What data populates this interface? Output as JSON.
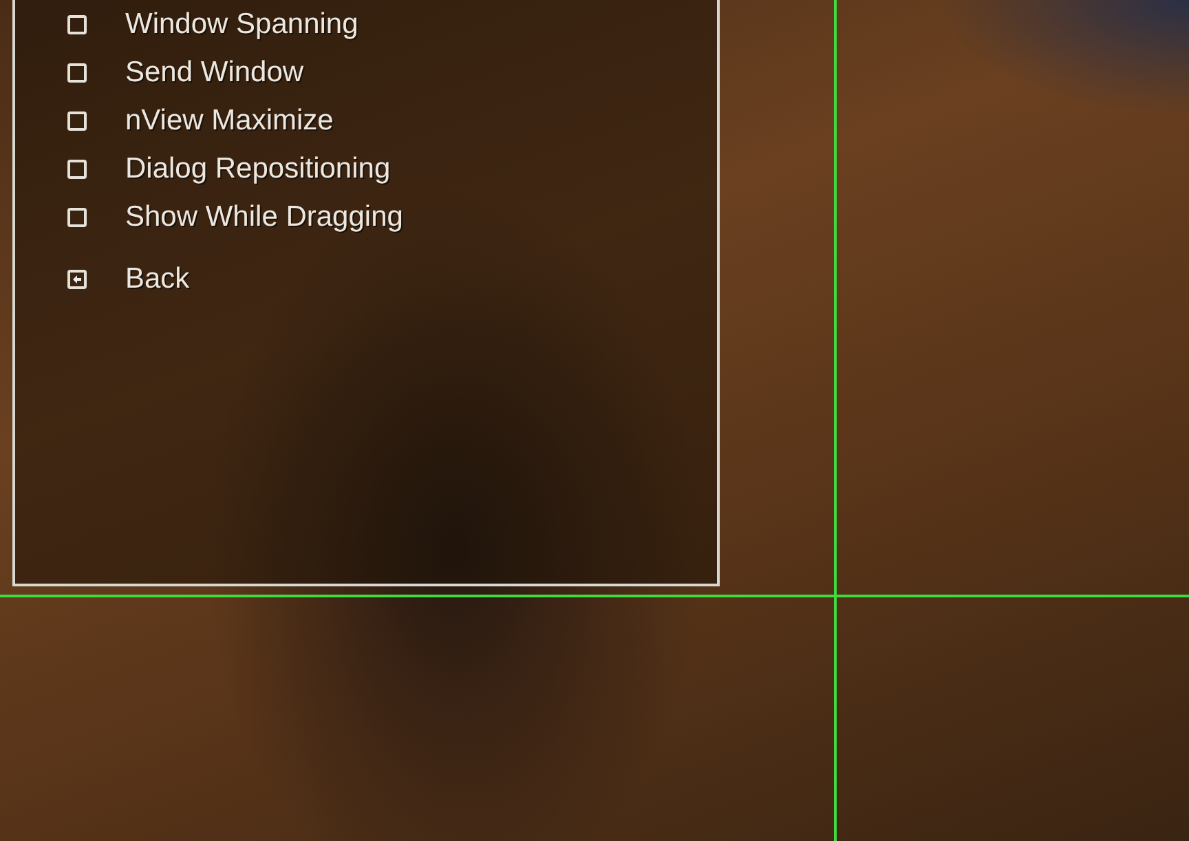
{
  "menu": {
    "items": [
      {
        "kind": "checkbox",
        "label": "Window Spanning",
        "checked": false
      },
      {
        "kind": "checkbox",
        "label": "Send Window",
        "checked": false
      },
      {
        "kind": "checkbox",
        "label": "nView Maximize",
        "checked": false
      },
      {
        "kind": "checkbox",
        "label": "Dialog Repositioning",
        "checked": false
      },
      {
        "kind": "checkbox",
        "label": "Show While Dragging",
        "checked": false
      },
      {
        "kind": "back",
        "label": "Back"
      }
    ]
  }
}
